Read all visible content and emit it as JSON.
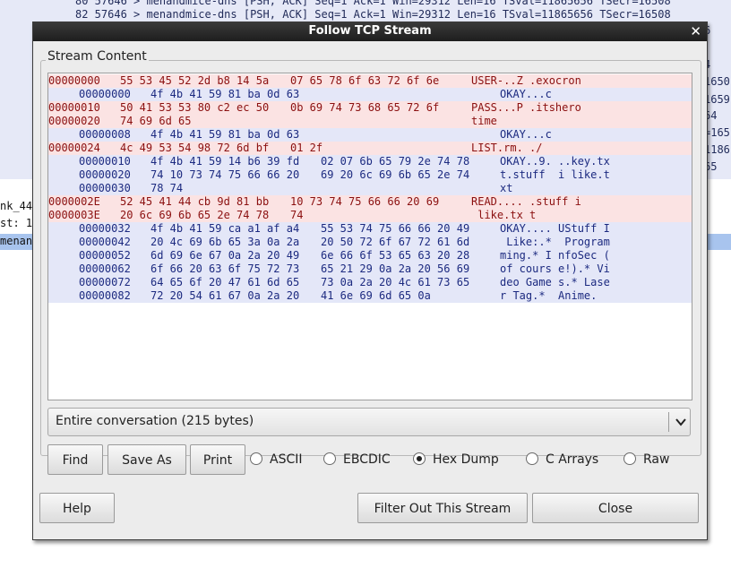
{
  "background": {
    "packet_lines": [
      "80 57646 > menandmice-dns [PSH, ACK] Seq=1 Ack=1 Win=29312 Len=16 TSval=11865656 TSecr=16508",
      "82 57646 > menandmice-dns [PSH, ACK] Seq=1 Ack=1 Win=29312 Len=16 TSval=11865656 TSecr=16508"
    ],
    "right_fragments": [
      "",
      "",
      "6",
      "",
      "4",
      "",
      "1650",
      "1659",
      "64",
      "=165",
      "1186",
      "65"
    ],
    "detail_left": [
      "nk_44",
      "st: 1",
      "menan"
    ]
  },
  "dialog": {
    "title": "Follow TCP Stream",
    "close_glyph": "✕",
    "group_label": "Stream Content",
    "stream_rows": [
      {
        "dir": "client",
        "offset": "00000000",
        "hex1": "55 53 45 52 2d b8 14 5a",
        "hex2": "07 65 78 6f 63 72 6f 6e",
        "ascii": "USER-..Z .exocron"
      },
      {
        "dir": "server",
        "offset": "00000000",
        "hex1": "4f 4b 41 59 81 ba 0d 63",
        "hex2": "",
        "ascii": "OKAY...c"
      },
      {
        "dir": "client",
        "offset": "00000010",
        "hex1": "50 41 53 53 80 c2 ec 50",
        "hex2": "0b 69 74 73 68 65 72 6f",
        "ascii": "PASS...P .itshero"
      },
      {
        "dir": "client",
        "offset": "00000020",
        "hex1": "74 69 6d 65",
        "hex2": "",
        "ascii": "time"
      },
      {
        "dir": "server",
        "offset": "00000008",
        "hex1": "4f 4b 41 59 81 ba 0d 63",
        "hex2": "",
        "ascii": "OKAY...c"
      },
      {
        "dir": "client",
        "offset": "00000024",
        "hex1": "4c 49 53 54 98 72 6d bf",
        "hex2": "01 2f",
        "ascii": "LIST.rm. ./"
      },
      {
        "dir": "server",
        "offset": "00000010",
        "hex1": "4f 4b 41 59 14 b6 39 fd",
        "hex2": "02 07 6b 65 79 2e 74 78",
        "ascii": "OKAY..9. ..key.tx"
      },
      {
        "dir": "server",
        "offset": "00000020",
        "hex1": "74 10 73 74 75 66 66 20",
        "hex2": "69 20 6c 69 6b 65 2e 74",
        "ascii": "t.stuff  i like.t"
      },
      {
        "dir": "server",
        "offset": "00000030",
        "hex1": "78 74",
        "hex2": "",
        "ascii": "xt"
      },
      {
        "dir": "client",
        "offset": "0000002E",
        "hex1": "52 45 41 44 cb 9d 81 bb",
        "hex2": "10 73 74 75 66 66 20 69",
        "ascii": "READ.... .stuff i"
      },
      {
        "dir": "client",
        "offset": "0000003E",
        "hex1": "20 6c 69 6b 65 2e 74 78",
        "hex2": "74",
        "ascii": " like.tx t"
      },
      {
        "dir": "server",
        "offset": "00000032",
        "hex1": "4f 4b 41 59 ca a1 af a4",
        "hex2": "55 53 74 75 66 66 20 49",
        "ascii": "OKAY.... UStuff I"
      },
      {
        "dir": "server",
        "offset": "00000042",
        "hex1": "20 4c 69 6b 65 3a 0a 2a",
        "hex2": "20 50 72 6f 67 72 61 6d",
        "ascii": " Like:.*  Program"
      },
      {
        "dir": "server",
        "offset": "00000052",
        "hex1": "6d 69 6e 67 0a 2a 20 49",
        "hex2": "6e 66 6f 53 65 63 20 28",
        "ascii": "ming.* I nfoSec ("
      },
      {
        "dir": "server",
        "offset": "00000062",
        "hex1": "6f 66 20 63 6f 75 72 73",
        "hex2": "65 21 29 0a 2a 20 56 69",
        "ascii": "of cours e!).* Vi"
      },
      {
        "dir": "server",
        "offset": "00000072",
        "hex1": "64 65 6f 20 47 61 6d 65",
        "hex2": "73 0a 2a 20 4c 61 73 65",
        "ascii": "deo Game s.* Lase"
      },
      {
        "dir": "server",
        "offset": "00000082",
        "hex1": "72 20 54 61 67 0a 2a 20",
        "hex2": "41 6e 69 6d 65 0a",
        "ascii": "r Tag.*  Anime."
      }
    ],
    "conversation": "Entire conversation (215 bytes)",
    "buttons": {
      "find": "Find",
      "save_as": "Save As",
      "print": "Print",
      "help": "Help",
      "filter_out": "Filter Out This Stream",
      "close": "Close"
    },
    "formats": [
      {
        "label": "ASCII",
        "selected": false
      },
      {
        "label": "EBCDIC",
        "selected": false
      },
      {
        "label": "Hex Dump",
        "selected": true
      },
      {
        "label": "C Arrays",
        "selected": false
      },
      {
        "label": "Raw",
        "selected": false
      }
    ]
  }
}
